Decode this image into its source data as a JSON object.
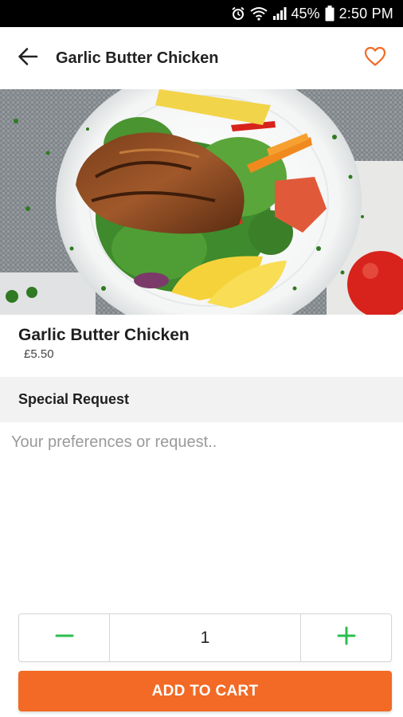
{
  "status_bar": {
    "battery": "45%",
    "time": "2:50 PM",
    "icons": [
      "alarm-icon",
      "wifi-icon",
      "signal-icon",
      "battery-icon"
    ]
  },
  "header": {
    "title": "Garlic Butter Chicken",
    "back_icon": "arrow-left-icon",
    "favorite_icon": "heart-outline-icon"
  },
  "product": {
    "name": "Garlic Butter Chicken",
    "price": "£5.50"
  },
  "special_request": {
    "heading": "Special Request",
    "placeholder": "Your preferences or request..",
    "value": ""
  },
  "quantity": {
    "value": "1",
    "decrement_icon": "minus-icon",
    "increment_icon": "plus-icon"
  },
  "cart": {
    "button_label": "ADD TO CART"
  },
  "colors": {
    "accent": "#f26a25",
    "stepper_icon": "#2bbf4e",
    "status_bar": "#000000"
  }
}
